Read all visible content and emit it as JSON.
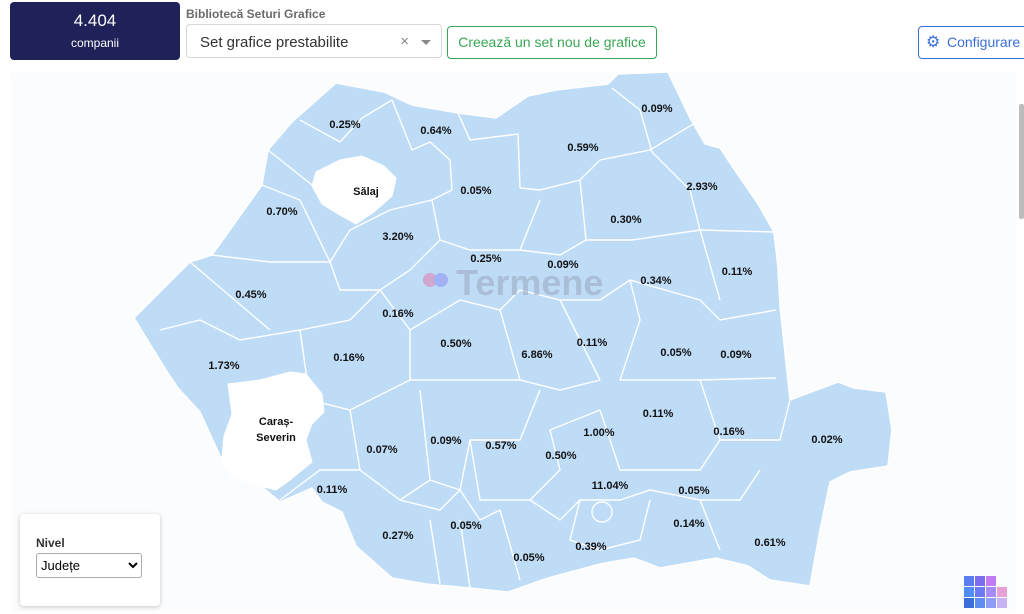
{
  "counter": {
    "value": "4.404",
    "label": "companii"
  },
  "library": {
    "label": "Bibliotecă Seturi Grafice",
    "selected": "Set grafice prestabilite",
    "clear_glyph": "×",
    "new_button": "Creează un set nou de grafice"
  },
  "config_button": {
    "label": "Configurare",
    "icon": "gear-icon"
  },
  "map": {
    "fill_color": "#bfdcf7",
    "highlight_color": "#ffffff",
    "border_color": "#ffffff",
    "watermark": "Termene",
    "named_regions": [
      "Sălaj",
      "Caraș-",
      "Severin"
    ],
    "percentages": [
      "0.09%",
      "0.25%",
      "0.64%",
      "0.59%",
      "2.93%",
      "0.05%",
      "0.30%",
      "0.70%",
      "3.20%",
      "0.25%",
      "0.09%",
      "0.34%",
      "0.11%",
      "0.45%",
      "0.16%",
      "1.73%",
      "0.16%",
      "0.50%",
      "6.86%",
      "0.11%",
      "0.05%",
      "0.09%",
      "0.11%",
      "0.07%",
      "0.09%",
      "0.57%",
      "1.00%",
      "0.16%",
      "0.02%",
      "0.50%",
      "0.11%",
      "11.04%",
      "0.05%",
      "0.05%",
      "0.27%",
      "0.14%",
      "0.05%",
      "0.39%",
      "0.61%"
    ]
  },
  "level": {
    "title": "Nivel",
    "selected": "Județe"
  }
}
